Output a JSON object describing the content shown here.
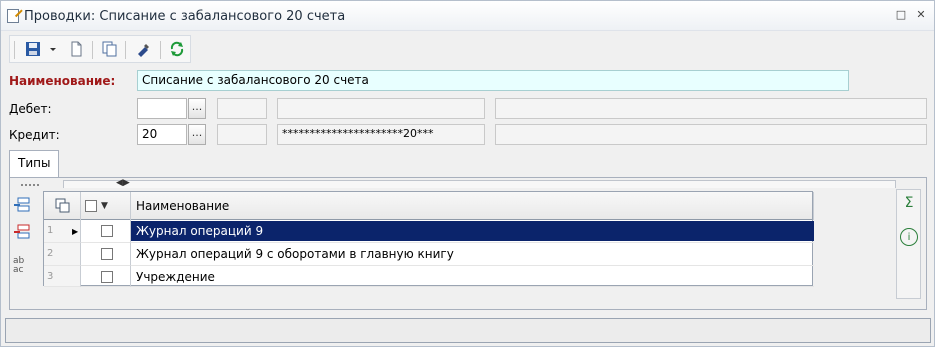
{
  "window": {
    "title": "Проводки: Списание с забалансового 20 счета",
    "restore_icon": "restore-icon",
    "close_icon": "close-icon"
  },
  "toolbar": {
    "items": [
      "save-icon",
      "dropdown-arrow-icon",
      "new-document-icon",
      "copy-icon",
      "edit-icon",
      "refresh-icon"
    ]
  },
  "form": {
    "name_label": "Наименование:",
    "name_value": "Списание с забалансового 20 счета",
    "debit_label": "Дебет:",
    "debit_value": "",
    "credit_label": "Кредит:",
    "credit_value": "20",
    "credit_mask": "**********************20***",
    "lookup_label": "..."
  },
  "tabs": [
    {
      "label": "Типы"
    }
  ],
  "grid": {
    "header": {
      "name": "Наименование"
    },
    "rows": [
      {
        "num": "1",
        "checked": false,
        "name": "Журнал операций 9"
      },
      {
        "num": "2",
        "checked": false,
        "name": "Журнал операций 9 с оборотами в главную книгу"
      },
      {
        "num": "3",
        "checked": false,
        "name": "Учреждение"
      }
    ]
  },
  "side_icons": [
    "add-row-icon",
    "delete-row-icon",
    "rename-icon"
  ],
  "right_icons": [
    "sum-icon",
    "info-icon"
  ]
}
